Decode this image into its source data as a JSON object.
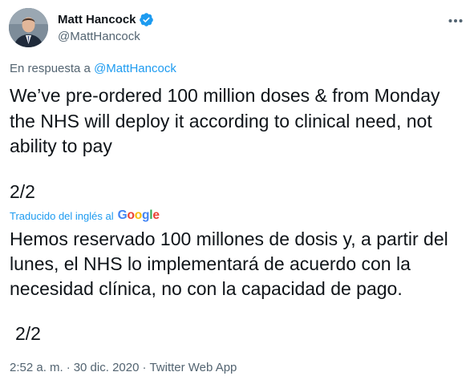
{
  "author": {
    "display_name": "Matt Hancock",
    "handle": "@MattHancock",
    "verified": true,
    "avatar_icon": "user-avatar"
  },
  "reply": {
    "prefix": "En respuesta a ",
    "handle": "@MattHancock"
  },
  "tweet": {
    "text": "We’ve pre-ordered 100 million doses & from Monday the NHS will deploy it according to clinical need, not ability to pay",
    "count": "2/2"
  },
  "translation": {
    "label": "Traducido del inglés al",
    "provider_letters": [
      "G",
      "o",
      "o",
      "g",
      "l",
      "e"
    ],
    "provider_colors": [
      "#4285F4",
      "#EA4335",
      "#FBBC05",
      "#4285F4",
      "#34A853",
      "#EA4335"
    ],
    "text": "Hemos reservado 100 millones de dosis y, a partir del lunes, el NHS lo implementará de acuerdo con la necesidad clínica, no con la capacidad de pago.",
    "count": "2/2"
  },
  "meta": {
    "time": "2:52 a. m.",
    "separator": "·",
    "date": "30 dic. 2020",
    "source": "Twitter Web App"
  },
  "colors": {
    "link": "#1d9bf0",
    "secondary_text": "#536471",
    "primary_text": "#0f1419"
  }
}
